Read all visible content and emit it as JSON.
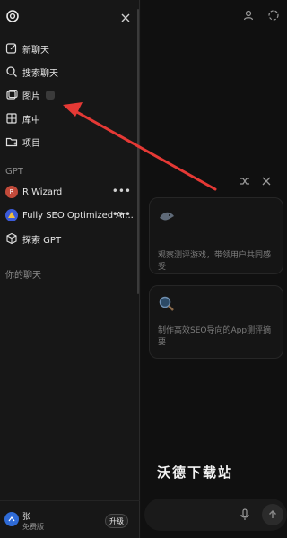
{
  "sidebar": {
    "new_chat": "新聊天",
    "search_chats": "搜索聊天",
    "images": "图片",
    "library": "库中",
    "projects": "项目",
    "gpt_section": "GPT",
    "gpts": [
      {
        "label": "R Wizard",
        "avatar_color": "#c24a3a"
      },
      {
        "label": "Fully SEO Optimized Ar...",
        "avatar_color": "#3c5bd8"
      },
      {
        "label": "探索 GPT",
        "avatar_color": ""
      }
    ],
    "chats_section": "你的聊天",
    "more_glyph": "•••"
  },
  "user": {
    "name": "张一",
    "plan": "免费版",
    "upgrade_label": "升级"
  },
  "main": {
    "cards": [
      {
        "text": "观察测评游戏，带领用户共同感受"
      },
      {
        "text": "制作高效SEO导向的App测评摘要"
      }
    ],
    "watermark": "沃德下载站"
  },
  "colors": {
    "annotation_arrow": "#e53935",
    "avatar_blue": "#2f6bd6"
  },
  "icons": [
    "logo-icon",
    "close-icon",
    "edit-icon",
    "search-icon",
    "images-icon",
    "library-icon",
    "folder-icon",
    "cube-icon",
    "profile-icon",
    "copy-icon",
    "shuffle-icon",
    "mic-icon",
    "send-icon"
  ]
}
